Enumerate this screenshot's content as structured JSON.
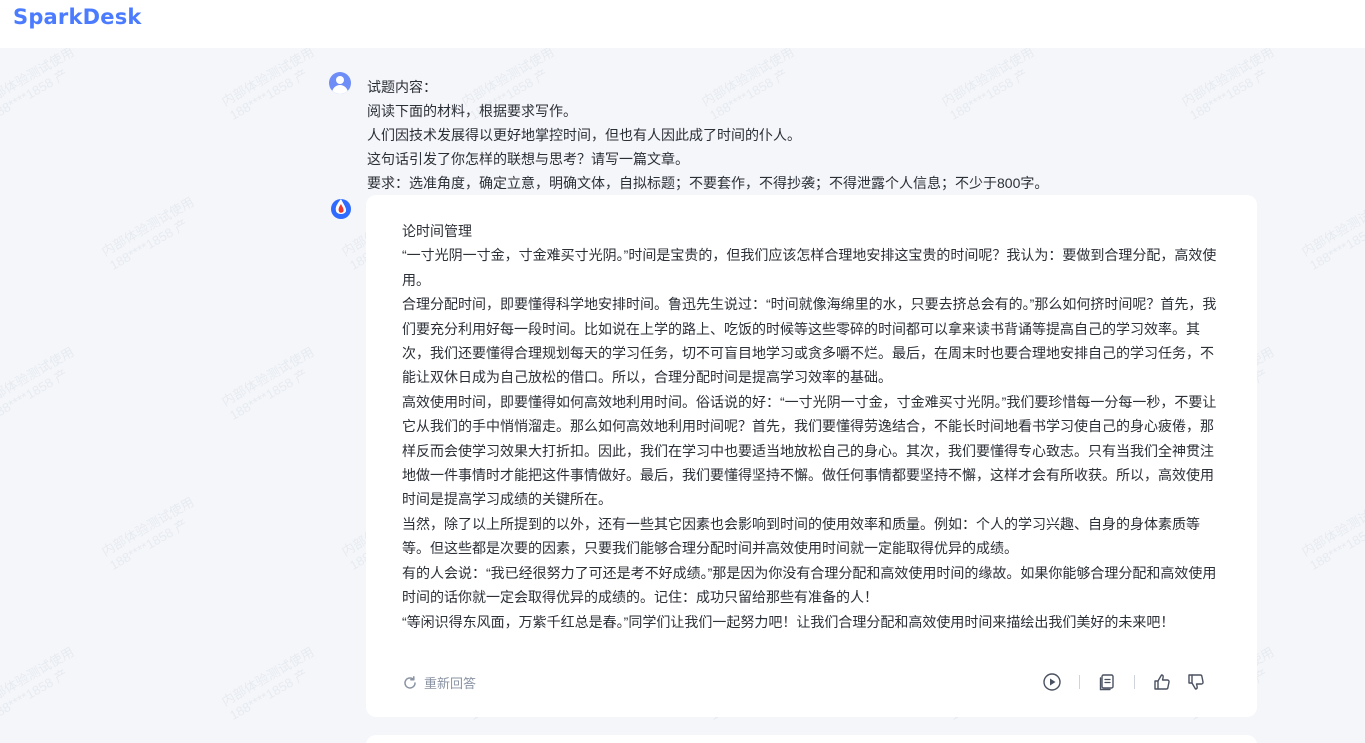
{
  "app": {
    "brand": "SparkDesk"
  },
  "watermark": {
    "line1": "内部体验测试使用",
    "line2": "188****1858 产"
  },
  "conversation": {
    "question_lines": [
      "试题内容：",
      "阅读下面的材料，根据要求写作。",
      "人们因技术发展得以更好地掌控时间，但也有人因此成了时间的仆人。",
      "这句话引发了你怎样的联想与思考？请写一篇文章。",
      "要求：选准角度，确定立意，明确文体，自拟标题；不要套作，不得抄袭；不得泄露个人信息；不少于800字。"
    ],
    "answer": {
      "title": "论时间管理",
      "paragraphs": [
        "“一寸光阴一寸金，寸金难买寸光阴。”时间是宝贵的，但我们应该怎样合理地安排这宝贵的时间呢？我认为：要做到合理分配，高效使用。",
        "合理分配时间，即要懂得科学地安排时间。鲁迅先生说过：“时间就像海绵里的水，只要去挤总会有的。”那么如何挤时间呢？首先，我们要充分利用好每一段时间。比如说在上学的路上、吃饭的时候等这些零碎的时间都可以拿来读书背诵等提高自己的学习效率。其次，我们还要懂得合理规划每天的学习任务，切不可盲目地学习或贪多嚼不烂。最后，在周末时也要合理地安排自己的学习任务，不能让双休日成为自己放松的借口。所以，合理分配时间是提高学习效率的基础。",
        "高效使用时间，即要懂得如何高效地利用时间。俗话说的好：“一寸光阴一寸金，寸金难买寸光阴。”我们要珍惜每一分每一秒，不要让它从我们的手中悄悄溜走。那么如何高效地利用时间呢？首先，我们要懂得劳逸结合，不能长时间地看书学习使自己的身心疲倦，那样反而会使学习效果大打折扣。因此，我们在学习中也要适当地放松自己的身心。其次，我们要懂得专心致志。只有当我们全神贯注地做一件事情时才能把这件事情做好。最后，我们要懂得坚持不懈。做任何事情都要坚持不懈，这样才会有所收获。所以，高效使用时间是提高学习成绩的关键所在。",
        "当然，除了以上所提到的以外，还有一些其它因素也会影响到时间的使用效率和质量。例如：个人的学习兴趣、自身的身体素质等等。但这些都是次要的因素，只要我们能够合理分配时间并高效使用时间就一定能取得优异的成绩。",
        "有的人会说：“我已经很努力了可还是考不好成绩。”那是因为你没有合理分配和高效使用时间的缘故。如果你能够合理分配和高效使用时间的话你就一定会取得优异的成绩的。记住：成功只留给那些有准备的人！",
        "“等闲识得东风面，万紫千红总是春。”同学们让我们一起努力吧！让我们合理分配和高效使用时间来描绘出我们美好的未来吧！"
      ],
      "regenerate_label": "重新回答"
    }
  },
  "icons": {
    "user_avatar": "user-avatar-icon",
    "bot_avatar": "spark-logo-icon",
    "regenerate": "refresh-icon",
    "play": "play-circle-icon",
    "copy": "copy-icon",
    "like": "thumbs-up-icon",
    "dislike": "thumbs-down-icon"
  },
  "colors": {
    "brand": "#4b7bff",
    "background": "#f4f6fa",
    "card": "#ffffff",
    "muted": "#8a93a3"
  }
}
